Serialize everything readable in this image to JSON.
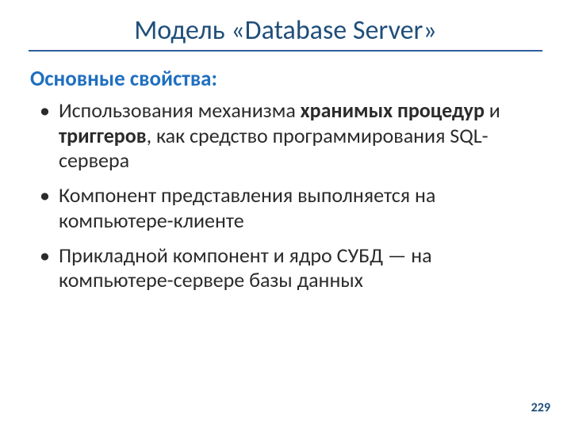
{
  "title": "Модель «Database Server»",
  "subtitle": "Основные свойства:",
  "bullets": [
    {
      "pre": "Использования механизма ",
      "b1": "хранимых процедур",
      "mid": " и ",
      "b2": "триггеров",
      "post": ", как средство программирования SQL-сервера"
    },
    {
      "text": "Компонент представления выполняется на компьютере-клиенте"
    },
    {
      "text": "Прикладной компонент и ядро СУБД — на компьютере-сервере базы данных"
    }
  ],
  "page_number": "229"
}
